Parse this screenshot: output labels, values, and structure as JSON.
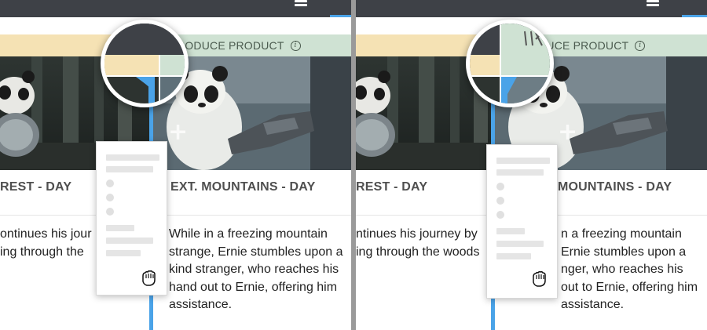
{
  "colors": {
    "topbar": "#3e4147",
    "accent_blue": "#4aa3e8",
    "header_yellow": "#f5e2b4",
    "header_green": "#cfe2d3",
    "divider": "#9a9a9a"
  },
  "icons": {
    "topbar_menu": "menu-icon",
    "info": "info-icon",
    "plus": "plus-icon",
    "grab": "grab-hand-icon"
  },
  "left_panel": {
    "column_a": {
      "scene_title": "REST - DAY",
      "description_lines": [
        "ontinues his jour",
        "ing through the"
      ]
    },
    "column_b": {
      "header": "RODUCE PRODUCT",
      "scene_title": "EXT. MOUNTAINS - DAY",
      "description_lines": [
        "While in a freezing mountain",
        "strange, Ernie stumbles upon a",
        "kind stranger, who reaches his",
        "hand out to Ernie, offering him",
        "assistance."
      ]
    }
  },
  "right_panel": {
    "column_a": {
      "scene_title": "REST - DAY",
      "description_lines": [
        "ntinues his journey by",
        "ing through the woods"
      ]
    },
    "column_b": {
      "header": "ODUCE PRODUCT",
      "scene_title": "MOUNTAINS - DAY",
      "description_lines": [
        "n a freezing mountain",
        "Ernie stumbles upon a",
        "nger, who reaches his",
        "out to Ernie, offering him",
        "assistance."
      ]
    }
  }
}
